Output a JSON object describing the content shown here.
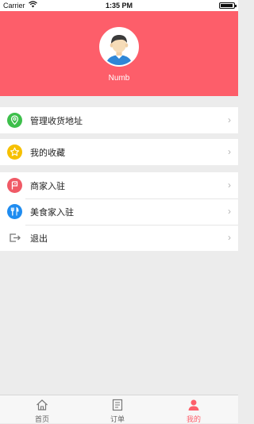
{
  "status_bar": {
    "carrier": "Carrier",
    "time": "1:35 PM"
  },
  "profile": {
    "username": "Numb"
  },
  "colors": {
    "accent": "#fd5e6a",
    "address_icon": "#3dbf4b",
    "favorites_icon": "#f6c000",
    "merchant_icon": "#f05a66",
    "food_icon": "#1f8cf0",
    "logout_icon": "#777777"
  },
  "menu": {
    "address": {
      "label": "管理收货地址",
      "icon": "location-pin-icon"
    },
    "favorites": {
      "label": "我的收藏",
      "icon": "star-icon"
    },
    "merchant": {
      "label": "商家入驻",
      "icon": "shop-flag-icon"
    },
    "food": {
      "label": "美食家入驻",
      "icon": "fork-knife-icon"
    },
    "logout": {
      "label": "退出",
      "icon": "exit-icon"
    }
  },
  "tabbar": {
    "home": "首页",
    "orders": "订单",
    "mine": "我的",
    "active": "mine"
  }
}
